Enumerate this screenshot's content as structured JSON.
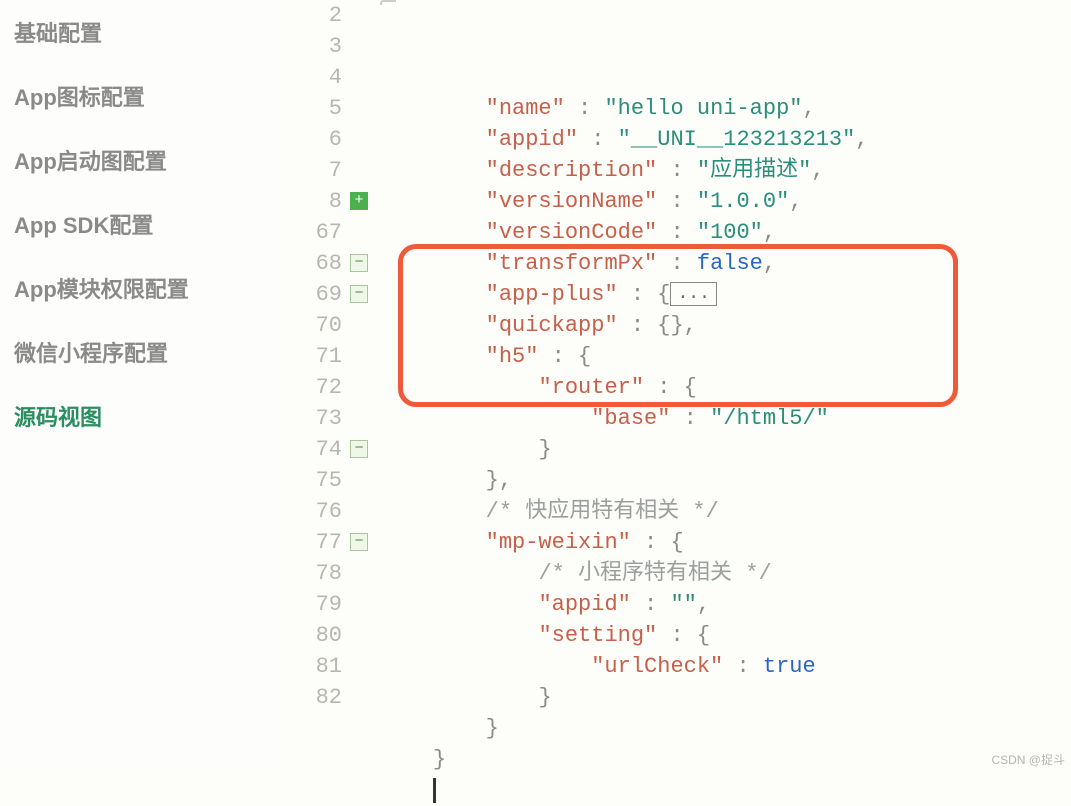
{
  "sidebar": {
    "items": [
      {
        "label": "基础配置",
        "active": false
      },
      {
        "label": "App图标配置",
        "active": false
      },
      {
        "label": "App启动图配置",
        "active": false
      },
      {
        "label": "App SDK配置",
        "active": false
      },
      {
        "label": "App模块权限配置",
        "active": false
      },
      {
        "label": "微信小程序配置",
        "active": false
      },
      {
        "label": "源码视图",
        "active": true
      }
    ]
  },
  "editor": {
    "lines": [
      {
        "n": 2,
        "fold": "",
        "indent": 2,
        "key": "name",
        "sep": " : ",
        "valType": "str",
        "val": "\"hello uni-app\"",
        "tail": ","
      },
      {
        "n": 3,
        "fold": "",
        "indent": 2,
        "key": "appid",
        "sep": " : ",
        "valType": "str",
        "val": "\"__UNI__123213213\"",
        "tail": ","
      },
      {
        "n": 4,
        "fold": "",
        "indent": 2,
        "key": "description",
        "sep": " : ",
        "valType": "str",
        "val": "\"应用描述\"",
        "tail": ","
      },
      {
        "n": 5,
        "fold": "",
        "indent": 2,
        "key": "versionName",
        "sep": " : ",
        "valType": "str",
        "val": "\"1.0.0\"",
        "tail": ","
      },
      {
        "n": 6,
        "fold": "",
        "indent": 2,
        "key": "versionCode",
        "sep": " : ",
        "valType": "str",
        "val": "\"100\"",
        "tail": ","
      },
      {
        "n": 7,
        "fold": "",
        "indent": 2,
        "key": "transformPx",
        "sep": " : ",
        "valType": "bool",
        "val": "false",
        "tail": ","
      },
      {
        "n": 8,
        "fold": "plus",
        "indent": 2,
        "key": "app-plus",
        "sep": " : ",
        "valType": "brace",
        "val": "{",
        "foldAfter": "...",
        "tail": ""
      },
      {
        "n": 67,
        "fold": "",
        "indent": 2,
        "key": "quickapp",
        "sep": " : ",
        "valType": "brace",
        "val": "{}",
        "tail": ","
      },
      {
        "n": 68,
        "fold": "minus",
        "indent": 2,
        "key": "h5",
        "sep": " : ",
        "valType": "brace",
        "val": "{",
        "tail": ""
      },
      {
        "n": 69,
        "fold": "minus",
        "indent": 3,
        "key": "router",
        "sep": " : ",
        "valType": "brace",
        "val": "{",
        "tail": ""
      },
      {
        "n": 70,
        "fold": "",
        "indent": 4,
        "key": "base",
        "sep": " : ",
        "valType": "str",
        "val": "\"/html5/\"",
        "tail": ""
      },
      {
        "n": 71,
        "fold": "",
        "indent": 3,
        "valType": "brace",
        "val": "}",
        "tail": ""
      },
      {
        "n": 72,
        "fold": "",
        "indent": 2,
        "valType": "brace",
        "val": "}",
        "tail": ","
      },
      {
        "n": 73,
        "fold": "",
        "indent": 2,
        "valType": "cmt",
        "val": "/* 快应用特有相关 */",
        "tail": ""
      },
      {
        "n": 74,
        "fold": "minus",
        "indent": 2,
        "key": "mp-weixin",
        "sep": " : ",
        "valType": "brace",
        "val": "{",
        "tail": ""
      },
      {
        "n": 75,
        "fold": "",
        "indent": 3,
        "valType": "cmt",
        "val": "/* 小程序特有相关 */",
        "tail": ""
      },
      {
        "n": 76,
        "fold": "",
        "indent": 3,
        "key": "appid",
        "sep": " : ",
        "valType": "str",
        "val": "\"\"",
        "tail": ","
      },
      {
        "n": 77,
        "fold": "minus",
        "indent": 3,
        "key": "setting",
        "sep": " : ",
        "valType": "brace",
        "val": "{",
        "tail": ""
      },
      {
        "n": 78,
        "fold": "",
        "indent": 4,
        "key": "urlCheck",
        "sep": " : ",
        "valType": "bool",
        "val": "true",
        "tail": ""
      },
      {
        "n": 79,
        "fold": "",
        "indent": 3,
        "valType": "brace",
        "val": "}",
        "tail": ""
      },
      {
        "n": 80,
        "fold": "",
        "indent": 2,
        "valType": "brace",
        "val": "}",
        "tail": ""
      },
      {
        "n": 81,
        "fold": "",
        "indent": 1,
        "valType": "brace",
        "val": "}",
        "tail": ""
      },
      {
        "n": 82,
        "fold": "",
        "indent": 1,
        "valType": "cursor",
        "val": "",
        "tail": ""
      }
    ]
  },
  "highlight": {
    "fromLine": 68,
    "toLine": 72
  },
  "foldLabels": {
    "plus": "+",
    "minus": "−",
    "ellipsis": "..."
  },
  "watermark": "CSDN @捉斗"
}
